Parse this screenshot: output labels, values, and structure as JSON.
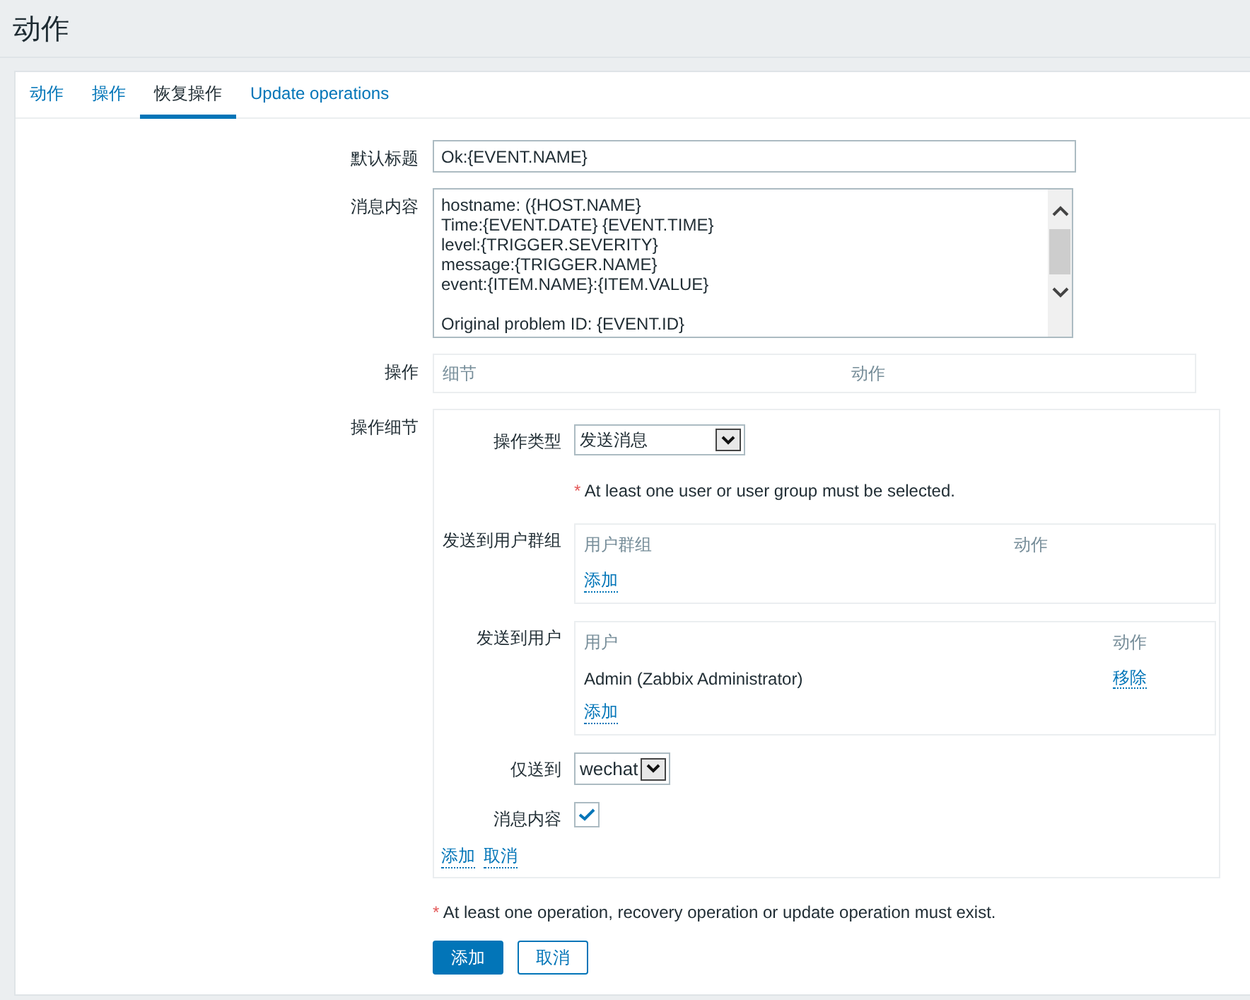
{
  "page": {
    "title": "动作"
  },
  "tabs": [
    {
      "label": "动作",
      "selected": false
    },
    {
      "label": "操作",
      "selected": false
    },
    {
      "label": "恢复操作",
      "selected": true
    },
    {
      "label": "Update operations",
      "selected": false
    }
  ],
  "form": {
    "default_subject": {
      "label": "默认标题",
      "value": "Ok:{EVENT.NAME}"
    },
    "message": {
      "label": "消息内容",
      "value": "hostname: ({HOST.NAME}\nTime:{EVENT.DATE} {EVENT.TIME}\nlevel:{TRIGGER.SEVERITY}\nmessage:{TRIGGER.NAME}\nevent:{ITEM.NAME}:{ITEM.VALUE}\n\nOriginal problem ID: {EVENT.ID}"
    },
    "operations": {
      "label": "操作",
      "columns": [
        "细节",
        "动作"
      ]
    },
    "operation_details": {
      "label": "操作细节",
      "operation_type": {
        "label": "操作类型",
        "value": "发送消息"
      },
      "warning": {
        "mark": "*",
        "text": "At least one user or user group must be selected."
      },
      "user_groups": {
        "label": "发送到用户群组",
        "columns": [
          "用户群组",
          "动作"
        ],
        "add_link": "添加"
      },
      "users": {
        "label": "发送到用户",
        "columns": [
          "用户",
          "动作"
        ],
        "rows": [
          {
            "name": "Admin (Zabbix Administrator)",
            "action": "移除"
          }
        ],
        "add_link": "添加"
      },
      "send_only_to": {
        "label": "仅送到",
        "value": "wechat"
      },
      "default_message": {
        "label": "消息内容",
        "checked": true
      },
      "links": [
        "添加",
        "取消"
      ]
    },
    "warning": {
      "mark": "*",
      "text": "At least one operation, recovery operation or update operation must exist."
    },
    "buttons": [
      {
        "label": "添加",
        "kind": "primary"
      },
      {
        "label": "取消",
        "kind": "secondary"
      }
    ]
  }
}
